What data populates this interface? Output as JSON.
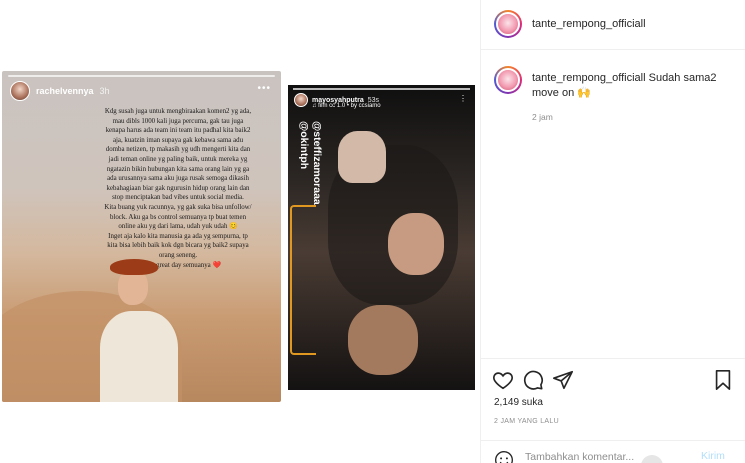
{
  "post": {
    "username": "tante_rempong_officiall"
  },
  "story1": {
    "username": "rachelvennya",
    "time": "3h",
    "more": "•••",
    "text": "Kdg susah juga untuk mengbiraakan komen2 yg ada,\nmau dibls 1000 kali juga percuma, gak tau juga\nkenapa harus ada team ini team itu padhal kita baik2\naja, kuatzin iman supaya gak kebawa sama adu\ndomba netizen, tp makasih yg udh mengerti kita dan\njadi teman online yg paling baik, untuk mereka yg\nngatazin bikin hubungan kita sama orang lain yg ga\nada urusannya sama aku juga rusak semoga dikasih\nkebahagiaan biar gak ngurusin hidup orang lain dan\nstop menciptakan bad vibes untuk social media.\nKita buang yuk racunnya, yg gak suka bisa unfollow/\nblock. Aku ga bs control semuanya tp buat temen\nonline aku yg dari lama, udah yuk udah 😊\nInget aja kalo kita manusia ga ada yg sempurna, tp\nkita bisa lebih baik kok dgn bicara yg baik2 supaya\norang seneng.\nHave a great day semuanya ❤️"
  },
  "story2": {
    "username": "mayosyahputra",
    "time": "53s",
    "subtitle": "♫ film cc 1.0 • by ccsiamo",
    "more": "⋮",
    "tags": [
      "@okintph",
      "@steffizamoraaa"
    ]
  },
  "caption": {
    "username": "tante_rempong_officiall",
    "text": "Sudah sama2 move on 🙌",
    "time": "2 jam"
  },
  "actions": {
    "likes": "2,149 suka",
    "posted": "2 JAM YANG LALU"
  },
  "comment": {
    "placeholder": "Tambahkan komentar...",
    "send": "Kirim"
  },
  "colors": {
    "accent_blue": "#b2dffc",
    "muted": "#8e8e8e",
    "text": "#262626"
  }
}
